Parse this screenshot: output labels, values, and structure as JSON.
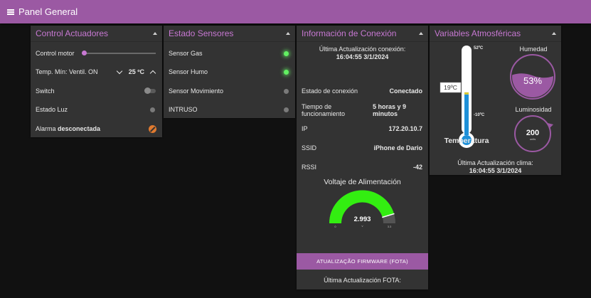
{
  "header": {
    "title": "Panel General"
  },
  "actuators": {
    "title": "Control Actuadores",
    "motor_label": "Control motor",
    "motor_value": 0,
    "temp_label": "Temp. Mín: Ventil. ON",
    "temp_value": "25 ºC",
    "switch_label": "Switch",
    "light_label": "Estado Luz",
    "alarm_prefix": "Alarma",
    "alarm_state": "desconectada"
  },
  "sensors": {
    "title": "Estado Sensores",
    "items": [
      {
        "label": "Sensor Gas",
        "active": true
      },
      {
        "label": "Sensor Humo",
        "active": true
      },
      {
        "label": "Sensor Movimiento",
        "active": false
      },
      {
        "label": "INTRUSO",
        "active": false
      }
    ]
  },
  "connection": {
    "title": "Información de Conexión",
    "last_update_label": "Última Actualización conexión:",
    "last_update_value": "16:04:55 3/1/2024",
    "rows": [
      {
        "k": "Estado de conexión",
        "v": "Conectado"
      },
      {
        "k": "Tiempo de funcionamiento",
        "v": "5 horas y 9 minutos"
      },
      {
        "k": "IP",
        "v": "172.20.10.7"
      },
      {
        "k": "SSID",
        "v": "iPhone de Dario"
      },
      {
        "k": "RSSI",
        "v": "-42"
      }
    ],
    "voltage_title": "Voltaje de Alimentación",
    "voltage_value": "2.993",
    "voltage_unit": "v",
    "voltage_min": "0",
    "voltage_max": "3.3",
    "voltage_fraction": 0.907,
    "fota_button": "ATUALIZAÇÃO FIRMWARE (FOTA)",
    "fota_last_label": "Última Actualización FOTA:"
  },
  "weather": {
    "title": "Variables Atmosféricas",
    "thermo_max": "52ºC",
    "thermo_min": "-10ºC",
    "thermo_value": "19ºC",
    "thermo_fraction": 0.468,
    "thermo_label": "Temperatura",
    "humidity_label": "Humedad",
    "humidity_value": "53%",
    "humidity_fraction": 0.53,
    "lum_label": "Luminosidad",
    "lum_value": "200",
    "lum_unit": "units",
    "last_update_label": "Última Actualización clima:",
    "last_update_value": "16:04:55 3/1/2024"
  },
  "colors": {
    "accent": "#9b59a3",
    "title_purple": "#c778d2",
    "led_on": "#62f062",
    "gauge_green": "#33ee11"
  }
}
